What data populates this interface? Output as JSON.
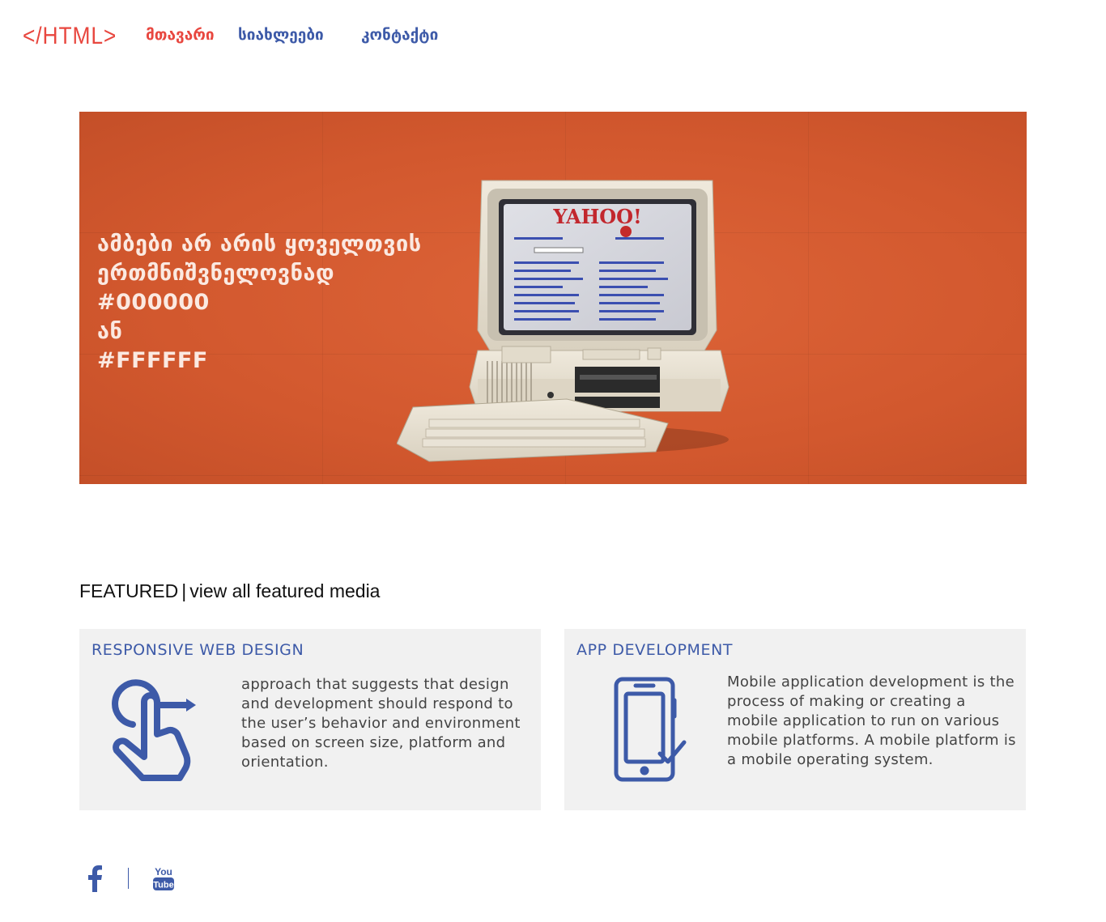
{
  "header": {
    "logo": "</HTML>",
    "nav": [
      {
        "label": "მთავარი",
        "active": true
      },
      {
        "label": "სიახლეები",
        "active": false
      },
      {
        "label": "კონტაქტი",
        "active": false
      }
    ]
  },
  "hero": {
    "lines": [
      "ამბები არ არის ყოველთვის",
      "ერთმნიშვნელოვნად",
      "#000000",
      "ან",
      "#FFFFFF"
    ],
    "image_text": "YAHOO!",
    "background_color": "#d85c31"
  },
  "featured": {
    "label": "FEATURED",
    "separator": "|",
    "link": "view all featured media",
    "cards": [
      {
        "title": "RESPONSIVE WEB DESIGN",
        "icon": "tap-swipe-icon",
        "body": "approach that suggests that design and development should respond to the user’s behavior and environment based on screen size, platform and orientation."
      },
      {
        "title": "APP DEVELOPMENT",
        "icon": "mobile-check-icon",
        "body": "Mobile application development is the process of making or creating a mobile application to run on various mobile platforms. A mobile platform is a mobile operating system."
      }
    ]
  },
  "footer": {
    "social": [
      {
        "name": "facebook-icon"
      },
      {
        "name": "youtube-icon",
        "text_top": "You",
        "text_bottom": "Tube"
      }
    ]
  },
  "colors": {
    "accent_red": "#e8473f",
    "accent_blue": "#3d5aa8",
    "card_bg": "#f1f1f1"
  }
}
